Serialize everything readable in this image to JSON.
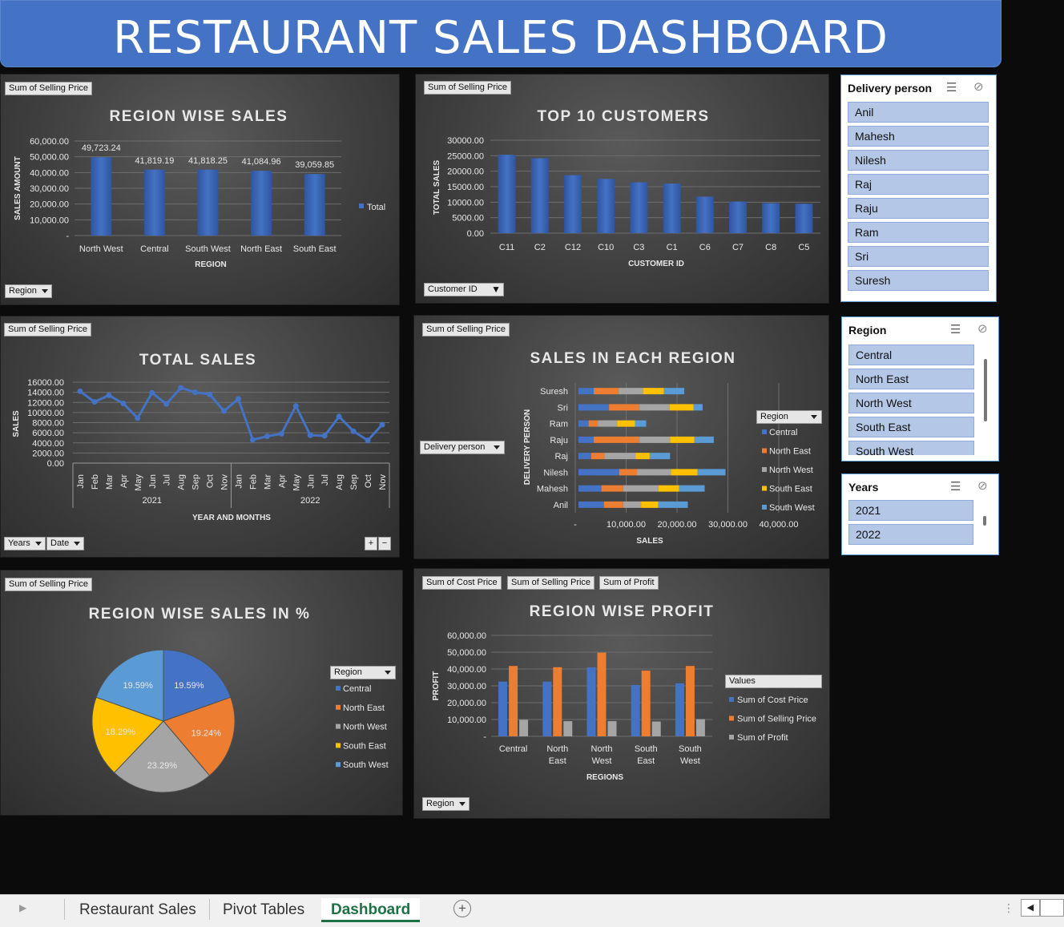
{
  "title": "RESTAURANT SALES DASHBOARD",
  "colors": {
    "central": "#4472c4",
    "north_east": "#ed7d31",
    "north_west": "#a5a5a5",
    "south_east": "#ffc000",
    "south_west": "#5b9bd5"
  },
  "charts": {
    "region_sales": {
      "field_button": "Sum of Selling Price",
      "filter_button": "Region",
      "legend": "Total",
      "chart_data": {
        "type": "bar",
        "title": "REGION WISE SALES",
        "xlabel": "REGION",
        "ylabel": "SALES AMOUNT",
        "categories": [
          "North West",
          "Central",
          "South West",
          "North East",
          "South East"
        ],
        "values": [
          49723.24,
          41819.19,
          41818.25,
          41084.96,
          39059.85
        ],
        "value_labels": [
          "49,723.24",
          "41,819.19",
          "41,818.25",
          "41,084.96",
          "39,059.85"
        ],
        "ylim": [
          0,
          60000
        ],
        "yticks": [
          "-",
          "10,000.00",
          "20,000.00",
          "30,000.00",
          "40,000.00",
          "50,000.00",
          "60,000.00"
        ],
        "legend_position": "right",
        "grid": true
      }
    },
    "top_customers": {
      "field_button": "Sum of Selling Price",
      "filter_button": "Customer ID",
      "chart_data": {
        "type": "bar",
        "title": "TOP 10 CUSTOMERS",
        "xlabel": "CUSTOMER ID",
        "ylabel": "TOTAL SALES",
        "categories": [
          "C11",
          "C2",
          "C12",
          "C10",
          "C3",
          "C1",
          "C6",
          "C7",
          "C8",
          "C5"
        ],
        "values": [
          25300,
          24200,
          18700,
          17500,
          16400,
          16000,
          11800,
          10200,
          9700,
          9500
        ],
        "ylim": [
          0,
          30000
        ],
        "yticks": [
          "0.00",
          "5000.00",
          "10000.00",
          "15000.00",
          "20000.00",
          "25000.00",
          "30000.00"
        ],
        "grid": true
      }
    },
    "total_sales": {
      "field_button": "Sum of Selling Price",
      "filter_buttons": [
        "Years",
        "Date"
      ],
      "pm_buttons": [
        "+",
        "−"
      ],
      "chart_data": {
        "type": "line",
        "title": "TOTAL SALES",
        "xlabel": "YEAR AND MONTHS",
        "ylabel": "SALES",
        "groups": [
          {
            "name": "2021",
            "months": [
              "Jan",
              "Feb",
              "Mar",
              "Apr",
              "May",
              "Jun",
              "Jul",
              "Aug",
              "Sep",
              "Oct",
              "Nov"
            ]
          },
          {
            "name": "2022",
            "months": [
              "Jan",
              "Feb",
              "Mar",
              "Apr",
              "May",
              "Jun",
              "Jul",
              "Aug",
              "Sep",
              "Oct",
              "Nov"
            ]
          }
        ],
        "values": [
          14200,
          12100,
          13400,
          11800,
          8900,
          13900,
          11700,
          14900,
          14000,
          13600,
          10300,
          12700,
          4600,
          5300,
          5800,
          11300,
          5500,
          5400,
          9200,
          6300,
          4500,
          7600
        ],
        "ylim": [
          0,
          16000
        ],
        "yticks": [
          "0.00",
          "2000.00",
          "4000.00",
          "6000.00",
          "8000.00",
          "10000.00",
          "12000.00",
          "14000.00",
          "16000.00"
        ],
        "grid": true
      }
    },
    "region_delivery": {
      "field_button": "Sum of Selling Price",
      "row_button": "Delivery person",
      "legend_button": "Region",
      "chart_data": {
        "type": "bar",
        "orientation": "horizontal",
        "stacked": true,
        "title": "SALES IN EACH REGION",
        "xlabel": "SALES",
        "ylabel": "DELIVERY PERSON",
        "categories": [
          "Suresh",
          "Sri",
          "Ram",
          "Raju",
          "Raj",
          "Nilesh",
          "Mahesh",
          "Anil"
        ],
        "series": [
          {
            "name": "Central",
            "values": [
              3000,
              6000,
              2000,
              3000,
              2500,
              8000,
              4500,
              5000
            ]
          },
          {
            "name": "North East",
            "values": [
              4900,
              6000,
              1800,
              9000,
              2600,
              3500,
              4300,
              3800
            ]
          },
          {
            "name": "North West",
            "values": [
              4800,
              5900,
              3800,
              6000,
              6100,
              6700,
              6900,
              3500
            ]
          },
          {
            "name": "South East",
            "values": [
              4100,
              4700,
              3500,
              4800,
              2800,
              5200,
              4100,
              3400
            ]
          },
          {
            "name": "South West",
            "values": [
              4000,
              1800,
              2200,
              3800,
              4000,
              5500,
              5000,
              5800
            ]
          }
        ],
        "xlim": [
          0,
          40000
        ],
        "xticks": [
          "-",
          "10,000.00",
          "20,000.00",
          "30,000.00",
          "40,000.00"
        ],
        "legend_position": "right",
        "grid": true
      }
    },
    "region_pct": {
      "field_button": "Sum of Selling Price",
      "legend_button": "Region",
      "chart_data": {
        "type": "pie",
        "title": "REGION WISE SALES IN %",
        "categories": [
          "Central",
          "North West",
          "South West",
          "North East",
          "South East"
        ],
        "legend_order": [
          "Central",
          "North East",
          "North West",
          "South East",
          "South West"
        ],
        "values": [
          19.59,
          19.24,
          23.29,
          18.29,
          19.59
        ],
        "labels": [
          "19.59%",
          "19.24%",
          "23.29%",
          "18.29%",
          "19.59%"
        ],
        "slice_colors": [
          "#4472c4",
          "#ed7d31",
          "#a5a5a5",
          "#ffc000",
          "#5b9bd5"
        ],
        "legend_position": "right"
      }
    },
    "region_profit": {
      "field_buttons": [
        "Sum of  Cost Price",
        "Sum of Selling Price",
        "Sum of Profit"
      ],
      "filter_button": "Region",
      "legend_button": "Values",
      "chart_data": {
        "type": "bar",
        "title": "REGION WISE PROFIT",
        "xlabel": "REGIONS",
        "ylabel": "PROFIT",
        "categories": [
          "Central",
          "North East",
          "North West",
          "South East",
          "South West"
        ],
        "category_lines": [
          [
            "Central"
          ],
          [
            "North",
            "East"
          ],
          [
            "North",
            "West"
          ],
          [
            "South",
            "East"
          ],
          [
            "South",
            "West"
          ]
        ],
        "series": [
          {
            "name": "Sum of  Cost Price",
            "values": [
              32500,
              32500,
              41000,
              30500,
              31500
            ]
          },
          {
            "name": "Sum of Selling Price",
            "values": [
              41819,
              41085,
              49723,
              39060,
              41818
            ]
          },
          {
            "name": "Sum of Profit",
            "values": [
              9800,
              9000,
              9000,
              8800,
              10200
            ]
          }
        ],
        "ylim": [
          0,
          60000
        ],
        "yticks": [
          "-",
          "10,000.00",
          "20,000.00",
          "30,000.00",
          "40,000.00",
          "50,000.00",
          "60,000.00"
        ],
        "legend_position": "right",
        "grid": true
      }
    }
  },
  "slicers": {
    "delivery": {
      "header": "Delivery person",
      "items": [
        "Anil",
        "Mahesh",
        "Nilesh",
        "Raj",
        "Raju",
        "Ram",
        "Sri",
        "Suresh"
      ]
    },
    "region": {
      "header": "Region",
      "items": [
        "Central",
        "North East",
        "North West",
        "South East",
        "South West"
      ]
    },
    "years": {
      "header": "Years",
      "items": [
        "2021",
        "2022"
      ]
    }
  },
  "sheet_tabs": [
    "Restaurant Sales",
    "Pivot Tables",
    "Dashboard"
  ],
  "active_tab": "Dashboard",
  "icons": {
    "multi_select": "multi-select-icon",
    "clear_filter": "clear-filter-icon",
    "add_sheet": "add-sheet-icon"
  }
}
